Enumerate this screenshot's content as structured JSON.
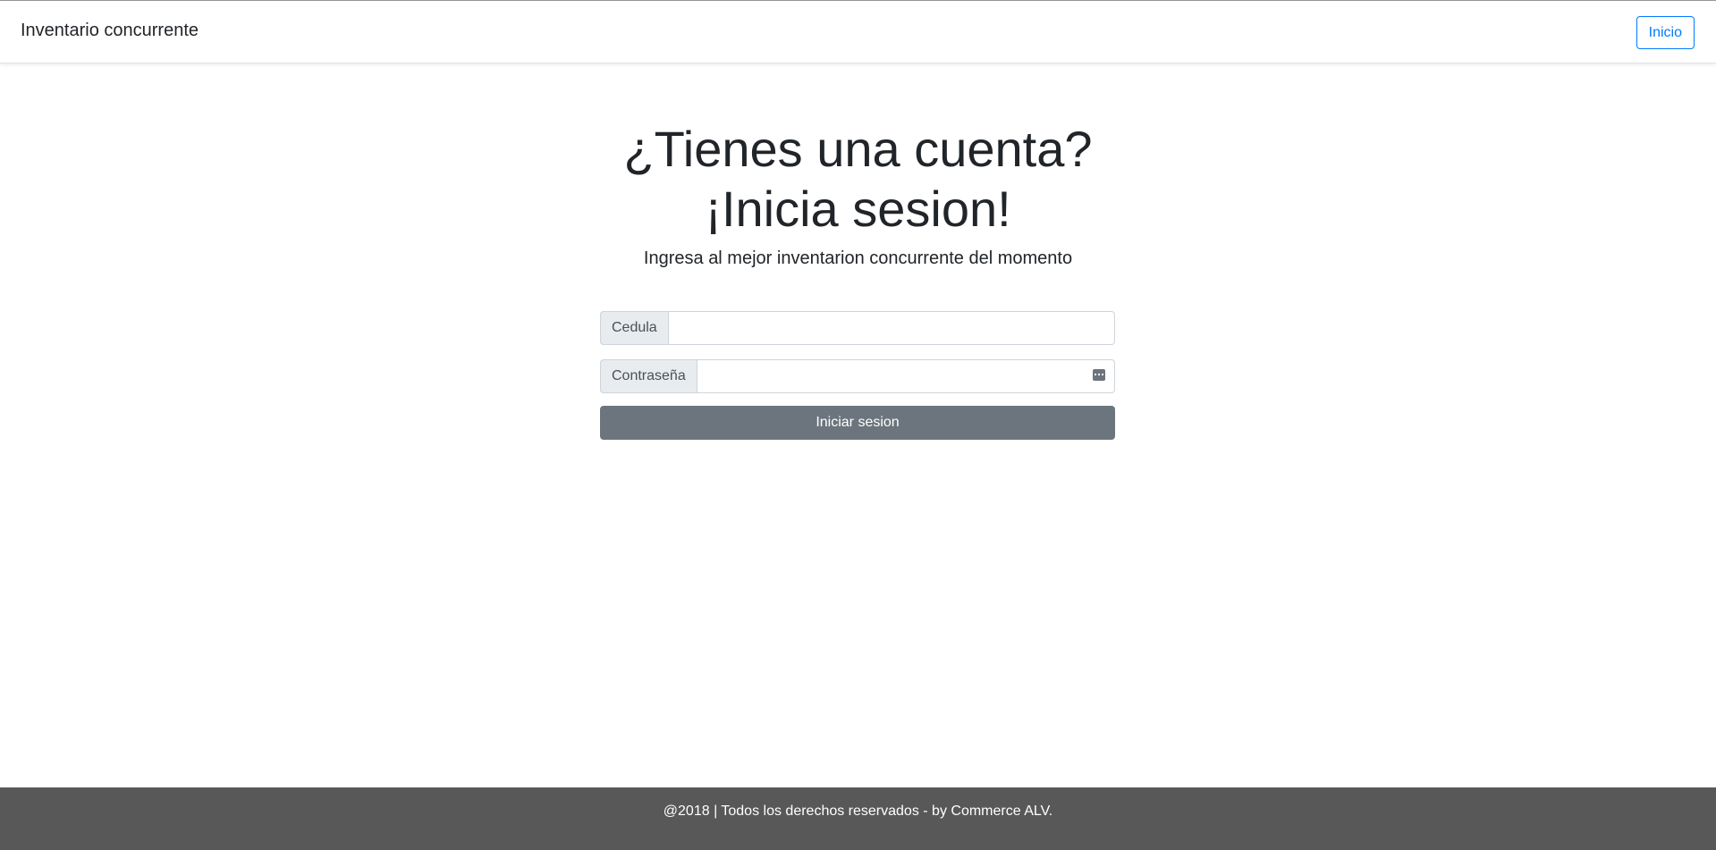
{
  "navbar": {
    "brand": "Inventario concurrente",
    "home_button": "Inicio"
  },
  "hero": {
    "title_line1": "¿Tienes una cuenta?",
    "title_line2": "¡Inicia sesion!",
    "subtitle": "Ingresa al mejor inventarion concurrente del momento"
  },
  "login_form": {
    "cedula_label": "Cedula",
    "cedula_value": "",
    "password_label": "Contraseña",
    "password_value": "",
    "password_icon": "password-manager-icon",
    "submit_label": "Iniciar sesion"
  },
  "footer": {
    "text": "@2018 | Todos los derechos reservados - by Commerce ALV."
  },
  "colors": {
    "primary": "#007bff",
    "secondary_button": "#6c757d",
    "footer_bg": "#585858"
  }
}
